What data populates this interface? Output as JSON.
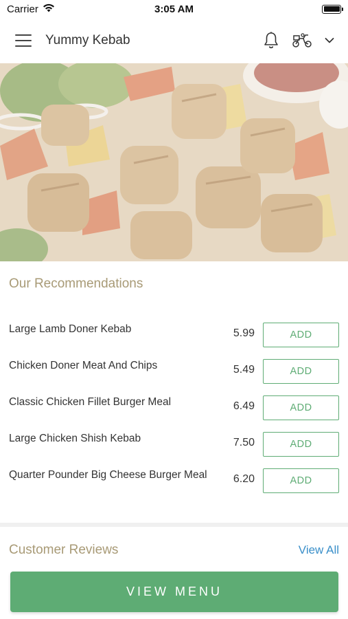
{
  "status_bar": {
    "carrier": "Carrier",
    "time": "3:05 AM",
    "battery_level": 1.0
  },
  "header": {
    "title": "Yummy Kebab",
    "icons": [
      "menu-icon",
      "bell-icon",
      "delivery-scooter-icon",
      "chevron-down-icon"
    ]
  },
  "hero": {
    "image": "kebab-skewers-photo"
  },
  "recommendations": {
    "title": "Our Recommendations",
    "items": [
      {
        "name": "Large Lamb Doner Kebab",
        "price": "5.99",
        "button": "ADD"
      },
      {
        "name": "Chicken Doner Meat And Chips",
        "price": "5.49",
        "button": "ADD"
      },
      {
        "name": "Classic Chicken Fillet Burger Meal",
        "price": "6.49",
        "button": "ADD"
      },
      {
        "name": "Large Chicken Shish Kebab",
        "price": "7.50",
        "button": "ADD"
      },
      {
        "name": "Quarter Pounder Big Cheese Burger Meal",
        "price": "6.20",
        "button": "ADD"
      }
    ]
  },
  "reviews": {
    "title": "Customer Reviews",
    "view_all": "View All"
  },
  "cta": {
    "label": "VIEW MENU"
  },
  "colors": {
    "accent_green": "#5eac74",
    "section_title": "#a89a76",
    "link_blue": "#3a8fc9"
  }
}
